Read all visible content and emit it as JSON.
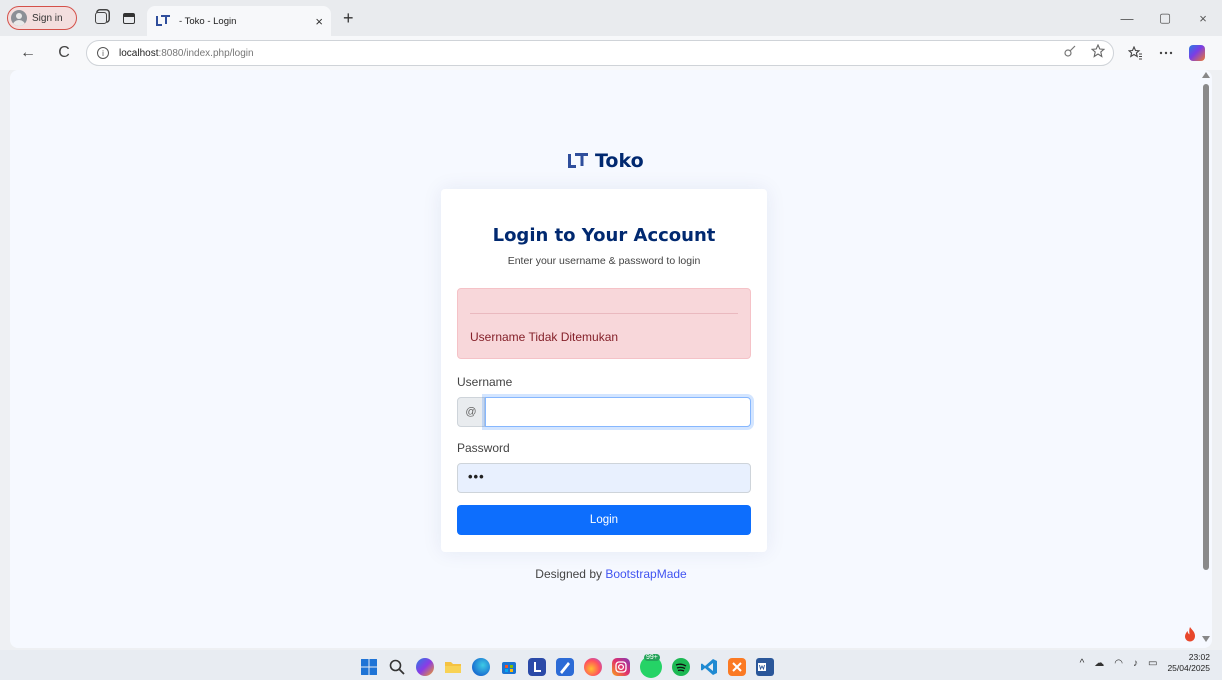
{
  "browser": {
    "signin_label": "Sign in",
    "tab_title": "- Toko - Login",
    "tab_close": "×",
    "new_tab": "+",
    "win_min": "—",
    "win_max": "▢",
    "win_close": "×",
    "back": "←",
    "refresh": "C",
    "url_host": "localhost",
    "url_path": ":8080/index.php/login",
    "info_glyph": "i"
  },
  "page": {
    "brand": "Toko",
    "card_title": "Login to Your Account",
    "card_subtitle": "Enter your username & password to login",
    "alert_message": "Username Tidak Ditemukan",
    "username_label": "Username",
    "username_prefix": "@",
    "username_value": "",
    "password_label": "Password",
    "password_value": "•••",
    "login_button": "Login",
    "credit_prefix": "Designed by ",
    "credit_link": "BootstrapMade"
  },
  "taskbar": {
    "time": "23:02",
    "date": "25/04/2025",
    "badge": "99+"
  },
  "colors": {
    "brand_navy": "#012970",
    "primary": "#0d6efd",
    "alert_bg": "#f8d7da",
    "alert_text": "#842029",
    "link": "#4154f1"
  }
}
